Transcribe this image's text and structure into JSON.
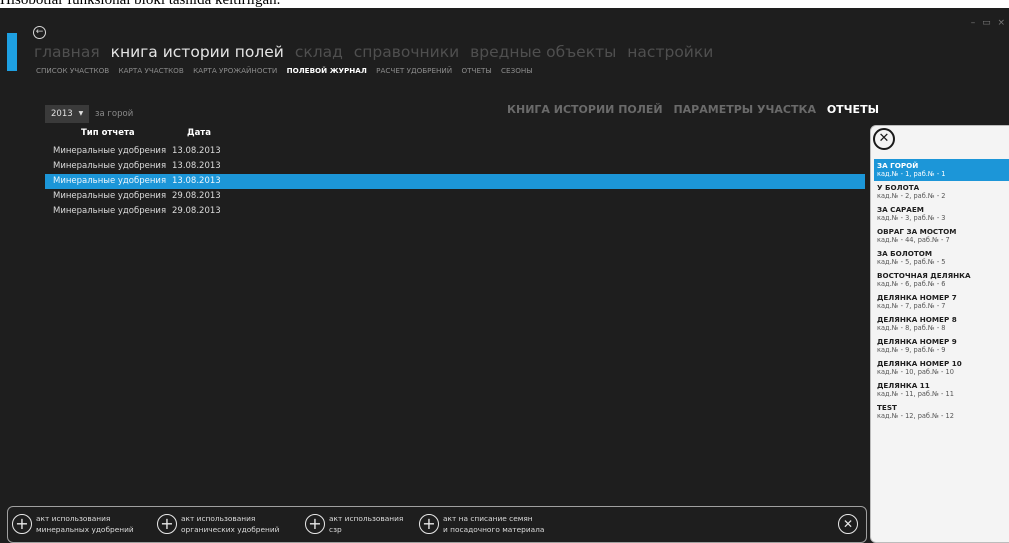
{
  "caption": "Hisobotlar funksional bloki tasnida keltirilgan.",
  "window_controls": "– ▭ ×",
  "back_icon": "back-arrow-icon",
  "main_nav": [
    {
      "label": "главная",
      "active": false
    },
    {
      "label": "книга истории полей",
      "active": true
    },
    {
      "label": "склад",
      "active": false
    },
    {
      "label": "справочники",
      "active": false
    },
    {
      "label": "вредные объекты",
      "active": false
    },
    {
      "label": "настройки",
      "active": false
    }
  ],
  "sub_nav": [
    {
      "label": "СПИСОК УЧАСТКОВ",
      "active": false
    },
    {
      "label": "КАРТА УЧАСТКОВ",
      "active": false
    },
    {
      "label": "КАРТА УРОЖАЙНОСТИ",
      "active": false
    },
    {
      "label": "ПОЛЕВОЙ ЖУРНАЛ",
      "active": true
    },
    {
      "label": "РАСЧЕТ УДОБРЕНИЙ",
      "active": false
    },
    {
      "label": "ОТЧЕТЫ",
      "active": false
    },
    {
      "label": "СЕЗОНЫ",
      "active": false
    }
  ],
  "filters": {
    "year": "2013",
    "field": "за горой"
  },
  "right_tabs": [
    {
      "label": "КНИГА ИСТОРИИ ПОЛЕЙ",
      "active": false
    },
    {
      "label": "ПАРАМЕТРЫ УЧАСТКА",
      "active": false
    },
    {
      "label": "ОТЧЕТЫ",
      "active": true
    }
  ],
  "report_table": {
    "columns": [
      "Тип отчета",
      "Дата"
    ],
    "rows": [
      {
        "type": "Минеральные удобрения",
        "date": "13.08.2013",
        "selected": false
      },
      {
        "type": "Минеральные удобрения",
        "date": "13.08.2013",
        "selected": false
      },
      {
        "type": "Минеральные удобрения",
        "date": "13.08.2013",
        "selected": true
      },
      {
        "type": "Минеральные удобрения",
        "date": "29.08.2013",
        "selected": false
      },
      {
        "type": "Минеральные удобрения",
        "date": "29.08.2013",
        "selected": false
      }
    ]
  },
  "plots": [
    {
      "name": "ЗА ГОРОЙ",
      "numbers": "кад.№ - 1, раб.№ - 1",
      "selected": true
    },
    {
      "name": "У БОЛОТА",
      "numbers": "кад.№ - 2, раб.№ - 2",
      "selected": false
    },
    {
      "name": "ЗА САРАЕМ",
      "numbers": "кад.№ - 3, раб.№ - 3",
      "selected": false
    },
    {
      "name": "ОВРАГ ЗА МОСТОМ",
      "numbers": "кад.№ - 44, раб.№ - 7",
      "selected": false
    },
    {
      "name": "ЗА БОЛОТОМ",
      "numbers": "кад.№ - 5, раб.№ - 5",
      "selected": false
    },
    {
      "name": "ВОСТОЧНАЯ ДЕЛЯНКА",
      "numbers": "кад.№ - 6, раб.№ - 6",
      "selected": false
    },
    {
      "name": "ДЕЛЯНКА НОМЕР 7",
      "numbers": "кад.№ - 7, раб.№ - 7",
      "selected": false
    },
    {
      "name": "ДЕЛЯНКА НОМЕР 8",
      "numbers": "кад.№ - 8, раб.№ - 8",
      "selected": false
    },
    {
      "name": "ДЕЛЯНКА НОМЕР 9",
      "numbers": "кад.№ - 9, раб.№ - 9",
      "selected": false
    },
    {
      "name": "ДЕЛЯНКА НОМЕР 10",
      "numbers": "кад.№ - 10, раб.№ - 10",
      "selected": false
    },
    {
      "name": "ДЕЛЯНКА 11",
      "numbers": "кад.№ - 11, раб.№ - 11",
      "selected": false
    },
    {
      "name": "TEST",
      "numbers": "кад.№ - 12, раб.№ - 12",
      "selected": false
    }
  ],
  "actions": [
    {
      "line1": "акт использования",
      "line2": "минеральных удобрений"
    },
    {
      "line1": "акт использования",
      "line2": "органических удобрений"
    },
    {
      "line1": "акт использования",
      "line2": "сзр"
    },
    {
      "line1": "акт на списание семян",
      "line2": "и посадочного материала"
    }
  ],
  "colors": {
    "accent": "#1ea0e2",
    "background": "#1e1e1e",
    "selection": "#1c96d8"
  }
}
